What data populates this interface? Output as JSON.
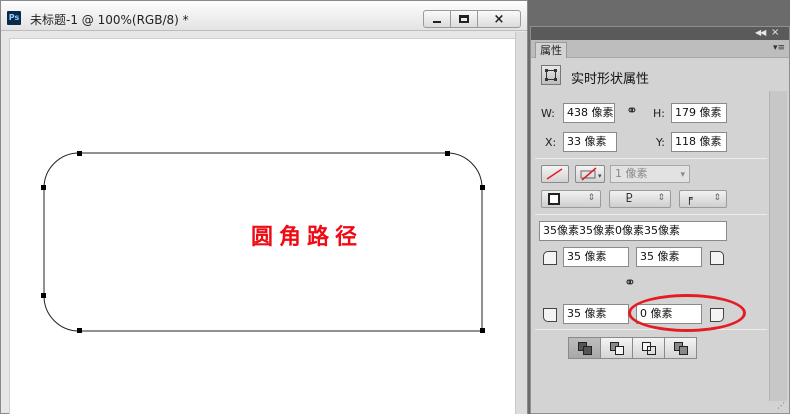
{
  "document": {
    "app_icon": "ps-logo-icon",
    "app_icon_text": "Ps",
    "title": "未标题-1 @ 100%(RGB/8) *",
    "controls": {
      "minimize": "minimize-icon",
      "maximize": "maximize-icon",
      "close": "×"
    },
    "canvas_text": "圆角路径"
  },
  "panel": {
    "tab": "属性",
    "header_title": "实时形状属性",
    "header_icon": "live-shape-icon",
    "dimensions": {
      "w_label": "W:",
      "w_value": "438 像素",
      "h_label": "H:",
      "h_value": "179 像素",
      "x_label": "X:",
      "x_value": "33 像素",
      "y_label": "Y:",
      "y_value": "118 像素"
    },
    "stroke_width": "1 像素",
    "corners": {
      "summary": "35像素35像素0像素35像素",
      "top_left": "35 像素",
      "top_right": "35 像素",
      "bottom_left": "35 像素",
      "bottom_right": "0 像素"
    },
    "highlight_color": "#e41c23"
  },
  "colors": {
    "canvas_text": "#f00a14",
    "panel_bg": "#d3d3d3",
    "workspace": "#6b6b6b"
  }
}
